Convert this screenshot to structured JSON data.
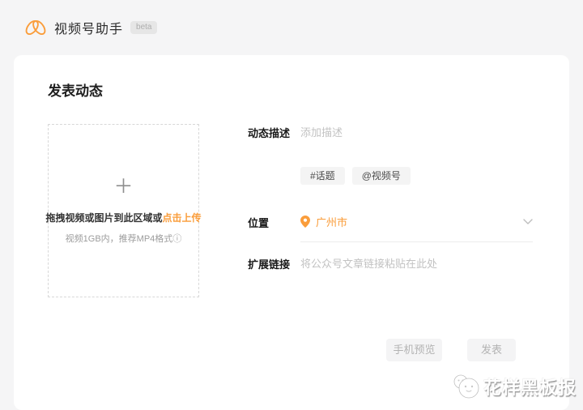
{
  "header": {
    "app_title": "视频号助手",
    "beta_label": "beta"
  },
  "page": {
    "title": "发表动态"
  },
  "upload": {
    "plus_glyph": "＋",
    "drag_text": "拖拽视频或图片到此区域或",
    "click_upload_text": "点击上传",
    "hint_text": "视频1GB内，推荐MP4格式",
    "info_glyph": "ⓘ"
  },
  "form": {
    "description": {
      "label": "动态描述",
      "placeholder": "添加描述"
    },
    "tags": [
      {
        "label": "#话题"
      },
      {
        "label": "@视频号"
      }
    ],
    "location": {
      "label": "位置",
      "value": "广州市"
    },
    "link": {
      "label": "扩展链接",
      "placeholder": "将公众号文章链接粘贴在此处"
    }
  },
  "actions": {
    "preview_label": "手机预览",
    "publish_label": "发表"
  },
  "watermark": {
    "text": "花样黑板报"
  },
  "colors": {
    "accent_orange": "#fa9d3b",
    "page_background": "#f5f5f6",
    "card_background": "#ffffff",
    "placeholder_gray": "#c2c2c2",
    "disabled_button_bg": "#f4f4f5"
  }
}
